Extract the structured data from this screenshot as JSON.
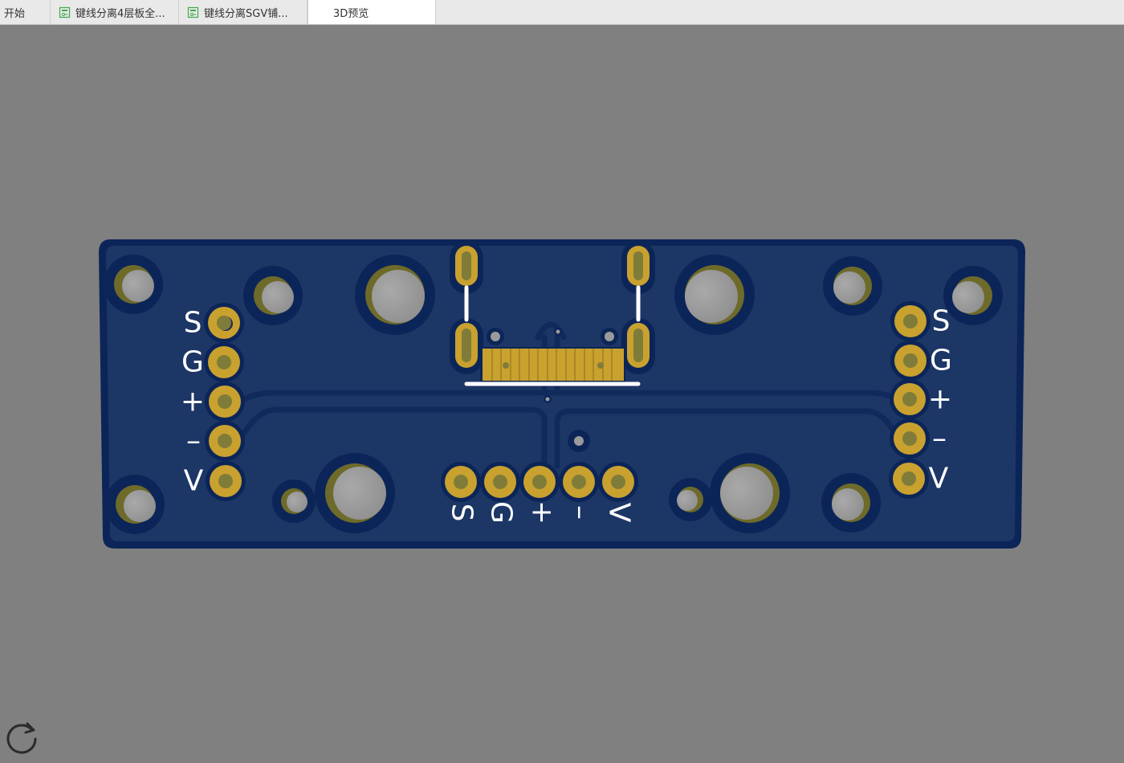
{
  "tabs": [
    {
      "label": "开始",
      "icon": "",
      "active": false
    },
    {
      "label": "键线分离4层板全...",
      "icon": "pcb-doc-icon",
      "active": false
    },
    {
      "label": "键线分离SGV铺...",
      "icon": "pcb-doc-icon",
      "active": false
    },
    {
      "label": "3D预览",
      "icon": "",
      "active": true
    }
  ],
  "viewer": {
    "background_color": "#808080",
    "board_color": "#1c3666",
    "board_outline_color": "#0b2459",
    "pad_color": "#c9a12f",
    "silkscreen_color": "#ffffff"
  },
  "board": {
    "left_header_labels": [
      "S",
      "G",
      "+",
      "–",
      "V"
    ],
    "right_header_labels": [
      "S",
      "G",
      "+",
      "–",
      "V"
    ],
    "bottom_header_labels": [
      "S",
      "G",
      "+",
      "–",
      "V"
    ]
  },
  "controls": {
    "refresh_icon": "refresh-icon"
  }
}
